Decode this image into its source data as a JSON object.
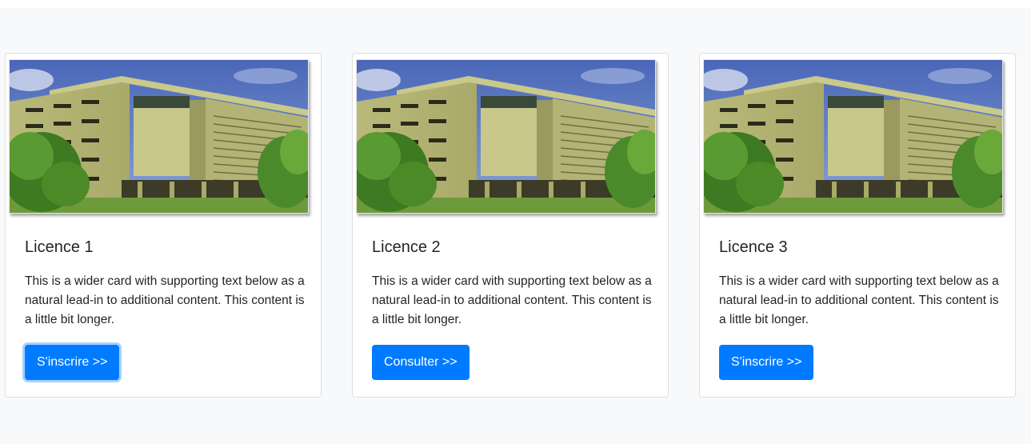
{
  "cards": [
    {
      "title": "Licence 1",
      "text": "This is a wider card with supporting text below as a natural lead-in to additional content. This content is a little bit longer.",
      "button_label": "S'inscrire >>"
    },
    {
      "title": "Licence 2",
      "text": "This is a wider card with supporting text below as a natural lead-in to additional content. This content is a little bit longer.",
      "button_label": "Consulter >>"
    },
    {
      "title": "Licence 3",
      "text": "This is a wider card with supporting text below as a natural lead-in to additional content. This content is a little bit longer.",
      "button_label": "S'inscrire >>"
    }
  ],
  "colors": {
    "button": "#007bff",
    "page_background": "#f8f9fa"
  }
}
